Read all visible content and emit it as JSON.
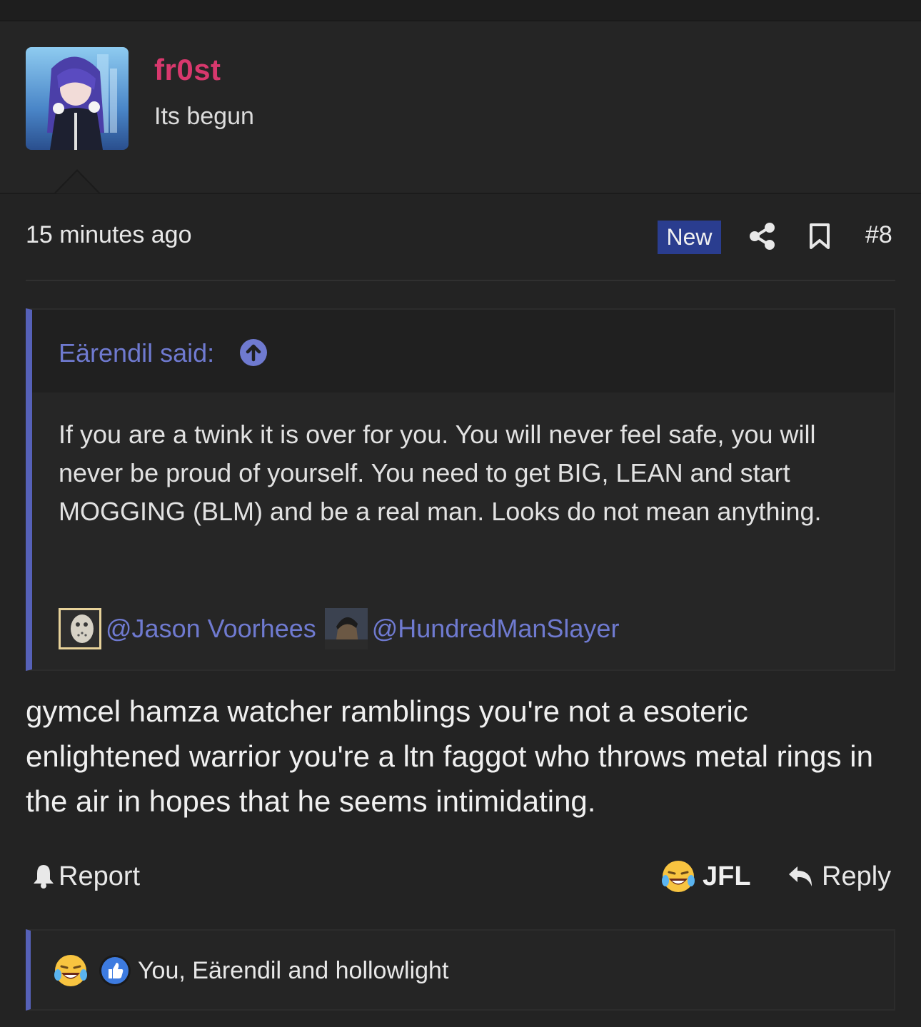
{
  "post": {
    "username": "fr0st",
    "user_title": "Its begun",
    "time": "15 minutes ago",
    "new_badge": "New",
    "post_number": "#8",
    "message": "gymcel hamza watcher ramblings you're not a esoteric enlightened warrior you're a ltn faggot who throws metal rings in the air in hopes that he seems intimidating."
  },
  "quote": {
    "author": "Eärendil said:",
    "body": "If you are a twink it is over for you. You will never feel safe, you will never be proud of yourself. You need to get BIG, LEAN and start MOGGING (BLM) and be a real man. Looks do not mean anything.",
    "mentions": [
      "@Jason Voorhees",
      "@HundredManSlayer"
    ]
  },
  "actions": {
    "report": "Report",
    "reaction": "JFL",
    "reply": "Reply"
  },
  "reactions": {
    "summary": "You, Eärendil and hollowlight"
  },
  "icons": {
    "share": "share-icon",
    "bookmark": "bookmark-icon",
    "quote_jump": "arrow-up-circle-icon",
    "report": "bell-icon",
    "reply": "reply-arrow-icon",
    "jfl": "crying-laughing-emoji-icon",
    "like": "thumbs-up-icon"
  },
  "colors": {
    "username": "#d8386d",
    "accent": "#5661b8",
    "link": "#6f7ad0",
    "new_badge": "#2a3d8f"
  }
}
